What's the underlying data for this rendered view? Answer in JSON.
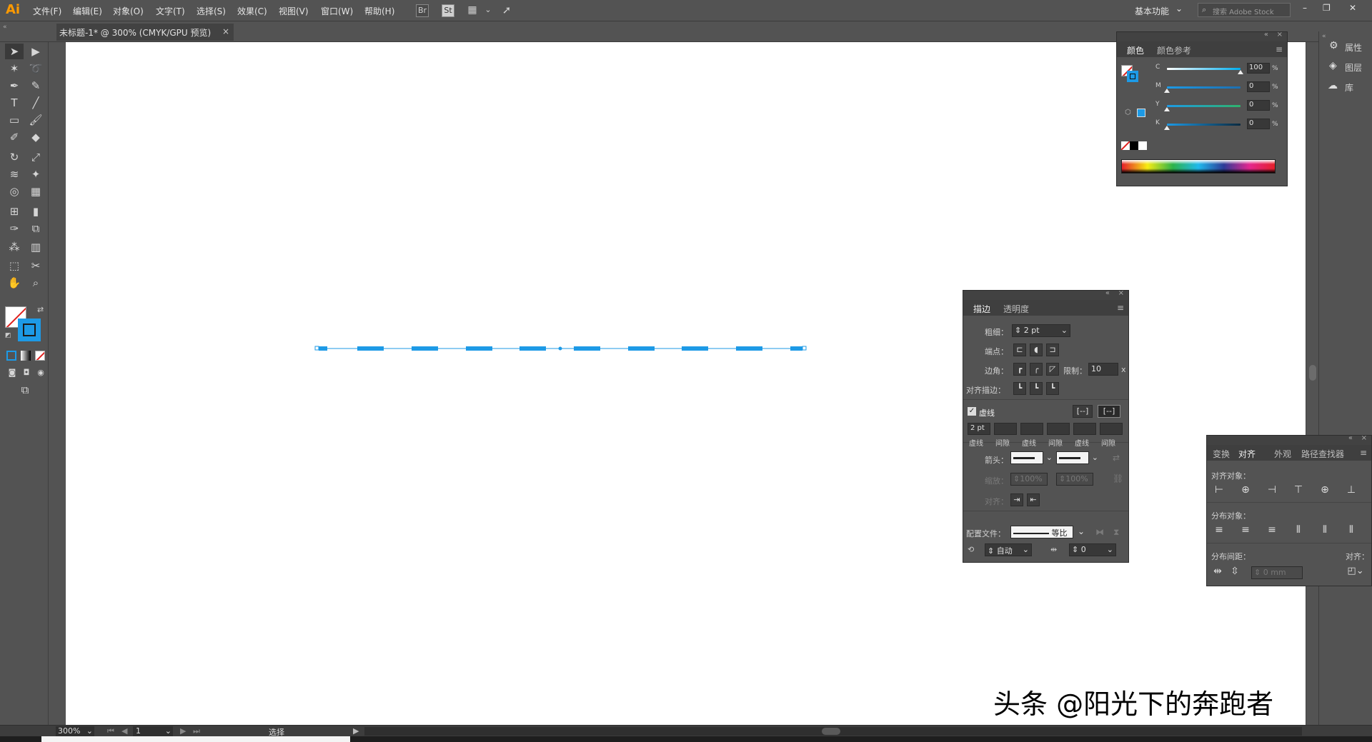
{
  "app": {
    "logo": "Ai"
  },
  "menu": [
    "文件(F)",
    "编辑(E)",
    "对象(O)",
    "文字(T)",
    "选择(S)",
    "效果(C)",
    "视图(V)",
    "窗口(W)",
    "帮助(H)"
  ],
  "toolbar_buttons": {
    "br": "Br",
    "st": "St"
  },
  "workspace": {
    "label": "基本功能",
    "chevron": "⌄"
  },
  "search": {
    "placeholder": "搜索 Adobe Stock"
  },
  "window_controls": {
    "min": "–",
    "max": "❐",
    "close": "✕"
  },
  "document_tab": {
    "title": "未标题-1* @ 300% (CMYK/GPU 预览)",
    "close": "×"
  },
  "color_panel": {
    "tabs": [
      "颜色",
      "颜色参考"
    ],
    "channels": [
      {
        "name": "C",
        "value": "100",
        "fraction": 1.0
      },
      {
        "name": "M",
        "value": "0",
        "fraction": 0.0
      },
      {
        "name": "Y",
        "value": "0",
        "fraction": 0.0
      },
      {
        "name": "K",
        "value": "0",
        "fraction": 0.0
      }
    ],
    "unit": "%"
  },
  "right_dock": {
    "items": [
      "属性",
      "图层",
      "库"
    ]
  },
  "stroke_panel": {
    "tabs": [
      "描边",
      "透明度"
    ],
    "weight_label": "粗细：",
    "weight_value": "2 pt",
    "cap_label": "端点：",
    "corner_label": "边角：",
    "limit_label": "限制：",
    "limit_value": "10",
    "limit_unit": "x",
    "align_label": "对齐描边：",
    "dashed_label": "虚线",
    "dashed_checked": true,
    "dash_fields": [
      "2 pt",
      "",
      "",
      "",
      "",
      ""
    ],
    "dash_labels": [
      "虚线",
      "间隙",
      "虚线",
      "间隙",
      "虚线",
      "间隙"
    ],
    "arrow_label": "箭头：",
    "scale_label": "缩放：",
    "scale_values": [
      "100%",
      "100%"
    ],
    "align_arrow_label": "对齐：",
    "profile_label": "配置文件：",
    "profile_value": "等比",
    "extra_value1": "自动",
    "extra_value2": "0"
  },
  "align_panel": {
    "tabs": [
      "变换",
      "对齐",
      "外观",
      "路径查找器"
    ],
    "align_objects_label": "对齐对象：",
    "distribute_objects_label": "分布对象：",
    "distribute_spacing_label": "分布间距：",
    "align_to_label": "对齐：",
    "spacing_value": "0 mm"
  },
  "status": {
    "zoom": "300%",
    "page": "1",
    "mode": "选择"
  },
  "watermark": "头条 @阳光下的奔跑者",
  "colors": {
    "accent": "#1d9ae6",
    "ui": "#535353"
  }
}
